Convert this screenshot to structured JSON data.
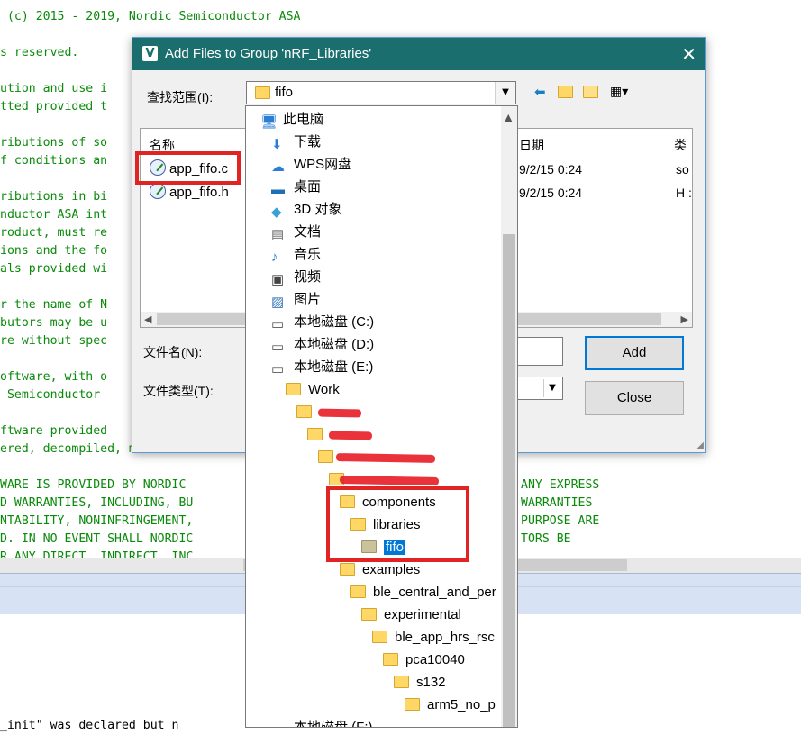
{
  "editor": {
    "lines": [
      " (c) 2015 - 2019, Nordic Semiconductor ASA",
      "",
      "s reserved.",
      "",
      "ution and use i",
      "tted provided t",
      "",
      "ributions of so",
      "f conditions an",
      "",
      "ributions in bi",
      "nductor ASA int",
      "roduct, must re",
      "ions and the fo",
      "als provided wi",
      "",
      "r the name of N",
      "butors may be u",
      "re without spec",
      "",
      "oftware, with o",
      " Semiconductor",
      "",
      "ftware provided",
      "ered, decompiled, modified",
      "",
      "WARE IS PROVIDED BY NORDIC",
      "D WARRANTIES, INCLUDING, BU",
      "NTABILITY, NONINFRINGEMENT,",
      "D. IN NO EVENT SHALL NORDIC",
      "R ANY DIRECT, INDIRECT, INC"
    ],
    "right_lines": [
      "ANY EXPRESS",
      "WARRANTIES",
      "PURPOSE ARE",
      "TORS BE"
    ],
    "output_line": "_init\" was declared but n"
  },
  "dialog": {
    "title": "Add Files to Group 'nRF_Libraries'",
    "title_icon": "V",
    "close_glyph": "✕",
    "look_in_label": "查找范围(I):",
    "look_in_value": "fifo",
    "columns": {
      "name": "名称",
      "date": "日期",
      "type": "类"
    },
    "files": [
      {
        "name": "app_fifo.c",
        "date": "9/2/15 0:24",
        "type": "so"
      },
      {
        "name": "app_fifo.h",
        "date": "9/2/15 0:24",
        "type": "H :"
      }
    ],
    "filename_label": "文件名(N):",
    "filetype_label": "文件类型(T):",
    "add_button": "Add",
    "close_button": "Close"
  },
  "dropdown": {
    "items": [
      {
        "label": "此电脑",
        "icon": "pc-icon"
      },
      {
        "label": "下载",
        "icon": "download-icon"
      },
      {
        "label": "WPS网盘",
        "icon": "cloud-icon"
      },
      {
        "label": "桌面",
        "icon": "desktop-icon"
      },
      {
        "label": "3D 对象",
        "icon": "3d-objects-icon"
      },
      {
        "label": "文档",
        "icon": "document-icon"
      },
      {
        "label": "音乐",
        "icon": "music-icon"
      },
      {
        "label": "视频",
        "icon": "video-icon"
      },
      {
        "label": "图片",
        "icon": "picture-icon"
      },
      {
        "label": "本地磁盘 (C:)",
        "icon": "drive-icon"
      },
      {
        "label": "本地磁盘 (D:)",
        "icon": "drive-icon"
      },
      {
        "label": "本地磁盘 (E:)",
        "icon": "drive-icon"
      },
      {
        "label": "Work",
        "icon": "folder-icon"
      },
      {
        "label": "",
        "icon": "folder-icon"
      },
      {
        "label": "",
        "icon": "folder-icon"
      },
      {
        "label": "",
        "icon": "folder-icon"
      },
      {
        "label": "",
        "icon": "folder-icon"
      },
      {
        "label": "components",
        "icon": "folder-icon"
      },
      {
        "label": "libraries",
        "icon": "folder-icon"
      },
      {
        "label": "fifo",
        "icon": "open-folder-icon"
      },
      {
        "label": "examples",
        "icon": "folder-icon"
      },
      {
        "label": "ble_central_and_per",
        "icon": "folder-icon"
      },
      {
        "label": "experimental",
        "icon": "folder-icon"
      },
      {
        "label": "ble_app_hrs_rsc",
        "icon": "folder-icon"
      },
      {
        "label": "pca10040",
        "icon": "folder-icon"
      },
      {
        "label": "s132",
        "icon": "folder-icon"
      },
      {
        "label": "arm5_no_p",
        "icon": "folder-icon"
      },
      {
        "label": "本地磁盘 (F:)",
        "icon": "drive-icon"
      }
    ]
  },
  "colors": {
    "code_text": "#0a8a0a",
    "titlebar": "#1b6e6e",
    "highlight_box": "#e02424",
    "selection": "#0078d7"
  }
}
